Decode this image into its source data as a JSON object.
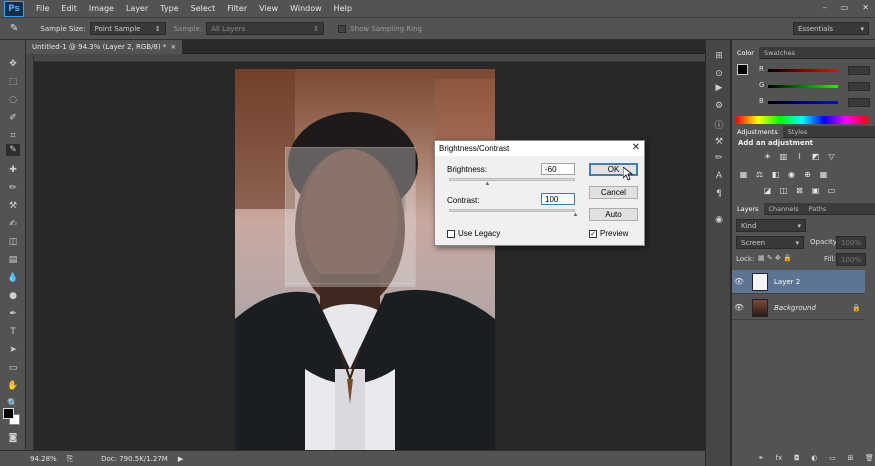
{
  "menubar": {
    "logo": "Ps",
    "items": [
      "File",
      "Edit",
      "Image",
      "Layer",
      "Type",
      "Select",
      "Filter",
      "View",
      "Window",
      "Help"
    ],
    "controls": [
      "–",
      "▭",
      "✕"
    ]
  },
  "options": {
    "sample_size_label": "Sample Size:",
    "sample_size_value": "Point Sample",
    "sample_label": "Sample:",
    "sample_value": "All Layers",
    "ring_label": "Show Sampling Ring",
    "workspace": "Essentials"
  },
  "document": {
    "tab_title": "Untitled-1 @ 94.3% (Layer 2, RGB/8) *",
    "tab_close": "×"
  },
  "status": {
    "zoom": "94.28%",
    "doc_info": "Doc: 790.5K/1.27M"
  },
  "dialog": {
    "title": "Brightness/Contrast",
    "brightness_label": "Brightness:",
    "brightness_value": "-60",
    "contrast_label": "Contrast:",
    "contrast_value": "100",
    "brightness_level": -60,
    "contrast_level": 100,
    "ok_label": "OK",
    "cancel_label": "Cancel",
    "auto_label": "Auto",
    "legacy_label": "Use Legacy",
    "legacy_checked": false,
    "preview_label": "Preview",
    "preview_checked": true
  },
  "panels": {
    "color_tabs": [
      "Color",
      "Swatches"
    ],
    "channels": [
      "R",
      "G",
      "B"
    ],
    "adjust_tabs": [
      "Adjustments",
      "Styles"
    ],
    "adjust_title": "Add an adjustment",
    "layers_tabs": [
      "Layers",
      "Channels",
      "Paths"
    ],
    "kind_label": "Kind",
    "blend_mode": "Screen",
    "opacity_label": "Opacity:",
    "opacity_value": "100%",
    "lock_label": "Lock:",
    "fill_label": "Fill:",
    "fill_value": "100%",
    "layers": [
      {
        "name": "Layer 2",
        "selected": true
      },
      {
        "name": "Background",
        "selected": false
      }
    ]
  }
}
